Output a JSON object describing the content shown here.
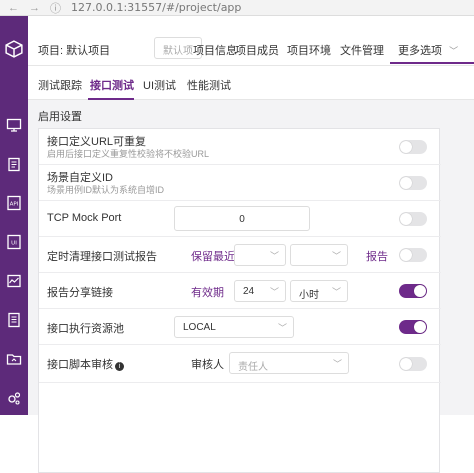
{
  "browser": {
    "url": "127.0.0.1:31557/#/project/app"
  },
  "topbar": {
    "project_label": "项目: 默认项目",
    "project_select_placeholder": "默认项",
    "nav": [
      "项目信息",
      "项目成员",
      "项目环境",
      "文件管理"
    ],
    "more": "更多选项",
    "more_caret": "﹀"
  },
  "subtabs": [
    "测试跟踪",
    "接口测试",
    "UI测试",
    "性能测试"
  ],
  "active_subtab": 1,
  "section_title": "启用设置",
  "rows": [
    {
      "title": "接口定义URL可重复",
      "desc": "启用后接口定义重复性校验将不校验URL",
      "toggle": false
    },
    {
      "title": "场景自定义ID",
      "desc": "场景用例ID默认为系统自增ID",
      "toggle": false
    },
    {
      "title": "TCP Mock Port",
      "value": "0",
      "toggle": false
    },
    {
      "title": "定时清理接口测试报告",
      "keep_label": "保留最近",
      "report_label": "报告",
      "select1": "",
      "select2": "",
      "toggle": false
    },
    {
      "title": "报告分享链接",
      "valid_label": "有效期",
      "number": "24",
      "unit": "小时",
      "toggle": true
    },
    {
      "title": "接口执行资源池",
      "pool": "LOCAL",
      "toggle": true
    },
    {
      "title": "接口脚本审核",
      "info_icon": "i",
      "reviewer_label": "审核人",
      "reviewer_placeholder": "责任人",
      "toggle": false
    }
  ],
  "colors": {
    "brand": "#6e2a8a",
    "sidebar": "#5d2a7a"
  },
  "icons": [
    "logo-cube-icon",
    "monitor-icon",
    "clipboard-icon",
    "api-icon",
    "ui-icon",
    "performance-icon",
    "report-icon",
    "project-icon",
    "settings-icon"
  ]
}
